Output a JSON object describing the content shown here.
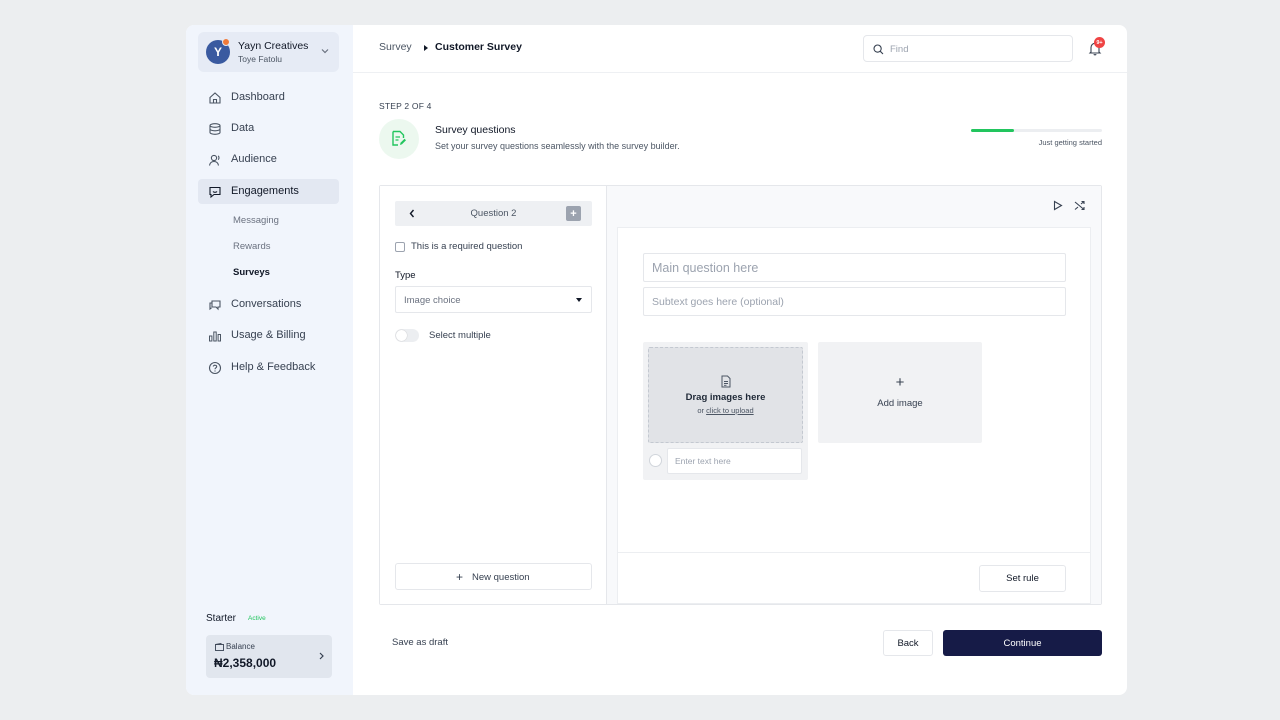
{
  "org": {
    "initial": "Y",
    "name": "Yayn Creatives",
    "user": "Toye Fatolu"
  },
  "nav": {
    "dashboard": "Dashboard",
    "data": "Data",
    "audience": "Audience",
    "engagements": "Engagements",
    "messaging": "Messaging",
    "rewards": "Rewards",
    "surveys": "Surveys",
    "conversations": "Conversations",
    "usage_billing": "Usage & Billing",
    "help": "Help & Feedback"
  },
  "plan": {
    "name": "Starter",
    "status": "Active",
    "balance_label": "Balance",
    "balance": "₦2,358,000"
  },
  "header": {
    "crumb_parent": "Survey",
    "crumb_current": "Customer Survey",
    "search_placeholder": "Find",
    "notif_count": "9+"
  },
  "step": {
    "label": "STEP 2 OF 4",
    "title": "Survey questions",
    "description": "Set your survey questions seamlessly with the survey builder.",
    "progress": 0.33,
    "progress_label": "Just getting started"
  },
  "editor": {
    "question_label": "Question 2",
    "required_label": "This is a required question",
    "type_label": "Type",
    "type_value": "Image choice",
    "multi_label": "Select multiple",
    "new_question": "New question"
  },
  "preview": {
    "main_placeholder": "Main question here",
    "sub_placeholder": "Subtext goes here (optional)",
    "drag_title": "Drag images here",
    "drag_or": "or",
    "drag_link": "click to upload",
    "option_placeholder": "Enter text here",
    "add_image": "Add image",
    "set_rule": "Set rule"
  },
  "footer": {
    "draft": "Save as draft",
    "back": "Back",
    "continue": "Continue"
  },
  "colors": {
    "accent": "#161b47",
    "progress": "#22c55e",
    "badge": "#ef4444"
  }
}
